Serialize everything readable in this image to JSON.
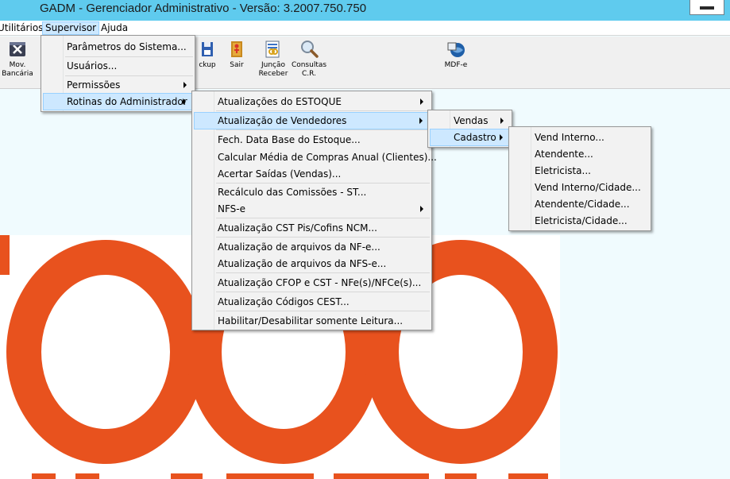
{
  "window": {
    "title": "GADM - Gerenciador Administrativo - Versão: 3.2007.750.750"
  },
  "menubar": {
    "items": [
      {
        "label": "Utilitários"
      },
      {
        "label": "Supervisor"
      },
      {
        "label": "Ajuda"
      }
    ]
  },
  "toolbar": {
    "buttons": [
      {
        "label": "Mov.\nBancária",
        "icon": "bank-movement-icon"
      },
      {
        "label": "ckup",
        "icon": "floppy-disk-icon"
      },
      {
        "label": "Sair",
        "icon": "exit-door-icon"
      },
      {
        "label": "Junção\nReceber",
        "icon": "document-join-icon"
      },
      {
        "label": "Consultas\nC.R.",
        "icon": "magnifier-icon"
      },
      {
        "label": "MDF-e",
        "icon": "mdfe-globe-icon"
      }
    ]
  },
  "supervisor_menu": {
    "items": [
      {
        "label": "Parâmetros do Sistema..."
      },
      {
        "label": "Usuários..."
      },
      {
        "label": "Permissões"
      },
      {
        "label": "Rotinas do Administrador"
      }
    ]
  },
  "rotinas_menu": {
    "items": [
      {
        "label": "Atualizações do ESTOQUE"
      },
      {
        "label": "Atualização de Vendedores"
      },
      {
        "label": "Fech. Data Base do Estoque..."
      },
      {
        "label": "Calcular Média de Compras Anual (Clientes)..."
      },
      {
        "label": "Acertar Saídas (Vendas)..."
      },
      {
        "label": "Recálculo das Comissões - ST..."
      },
      {
        "label": "NFS-e"
      },
      {
        "label": "Atualização CST Pis/Cofins NCM..."
      },
      {
        "label": "Atualização de arquivos da NF-e..."
      },
      {
        "label": "Atualização de arquivos da NFS-e..."
      },
      {
        "label": "Atualização CFOP e CST - NFe(s)/NFCe(s)..."
      },
      {
        "label": "Atualização Códigos CEST..."
      },
      {
        "label": "Habilitar/Desabilitar somente Leitura..."
      }
    ]
  },
  "vendedores_menu": {
    "items": [
      {
        "label": "Vendas"
      },
      {
        "label": "Cadastro"
      }
    ]
  },
  "cadastro_menu": {
    "items": [
      {
        "label": "Vend Interno..."
      },
      {
        "label": "Atendente..."
      },
      {
        "label": "Eletricista..."
      },
      {
        "label": "Vend Interno/Cidade..."
      },
      {
        "label": "Atendente/Cidade..."
      },
      {
        "label": "Eletricista/Cidade..."
      }
    ]
  },
  "colors": {
    "titlebar": "#5fcbee",
    "menu_highlight": "#cde8ff",
    "logo_orange": "#e8521e",
    "background": "#f0fbfe"
  }
}
